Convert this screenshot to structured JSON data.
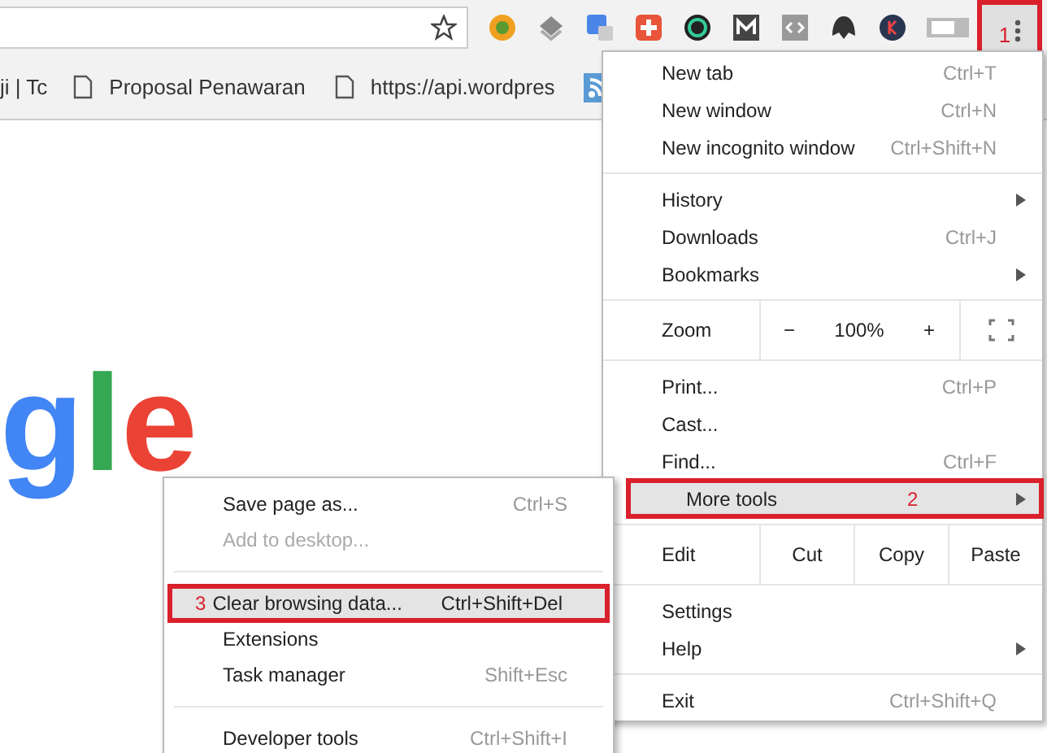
{
  "toolbar": {
    "menu_button": {
      "annotation": "1"
    }
  },
  "bookmarks": [
    {
      "kind": "text",
      "label": "ji | Tc"
    },
    {
      "kind": "page",
      "label": "Proposal Penawaran"
    },
    {
      "kind": "page",
      "label": "https://api.wordpres"
    },
    {
      "kind": "feed"
    }
  ],
  "logo_letters": [
    {
      "text": "g",
      "color": "#4285f4"
    },
    {
      "text": "l",
      "color": "#34a853"
    },
    {
      "text": "e",
      "color": "#ea4335"
    }
  ],
  "menu": [
    {
      "kind": "item",
      "label": "New tab",
      "shortcut": "Ctrl+T",
      "arrow": false,
      "selected": false
    },
    {
      "kind": "item",
      "label": "New window",
      "shortcut": "Ctrl+N",
      "arrow": false,
      "selected": false
    },
    {
      "kind": "item",
      "label": "New incognito window",
      "shortcut": "Ctrl+Shift+N",
      "arrow": false,
      "selected": false
    },
    {
      "kind": "separator"
    },
    {
      "kind": "item",
      "label": "History",
      "arrow": true,
      "selected": false
    },
    {
      "kind": "item",
      "label": "Downloads",
      "shortcut": "Ctrl+J",
      "arrow": false,
      "selected": false
    },
    {
      "kind": "item",
      "label": "Bookmarks",
      "arrow": true,
      "selected": false
    },
    {
      "kind": "separator"
    },
    {
      "kind": "zoom",
      "label": "Zoom",
      "minus": "−",
      "value": "100%",
      "plus": "+"
    },
    {
      "kind": "separator"
    },
    {
      "kind": "item",
      "label": "Print...",
      "shortcut": "Ctrl+P",
      "arrow": false,
      "selected": false
    },
    {
      "kind": "item",
      "label": "Cast...",
      "arrow": false,
      "selected": false
    },
    {
      "kind": "item",
      "label": "Find...",
      "shortcut": "Ctrl+F",
      "arrow": false,
      "selected": false
    },
    {
      "kind": "item",
      "label": "More tools",
      "annotation": "2",
      "arrow": true,
      "selected": true
    },
    {
      "kind": "separator"
    },
    {
      "kind": "edit",
      "label": "Edit",
      "buttons": [
        "Cut",
        "Copy",
        "Paste"
      ]
    },
    {
      "kind": "separator"
    },
    {
      "kind": "item",
      "label": "Settings",
      "arrow": false,
      "selected": false
    },
    {
      "kind": "item",
      "label": "Help",
      "arrow": true,
      "selected": false
    },
    {
      "kind": "separator"
    },
    {
      "kind": "item",
      "label": "Exit",
      "shortcut": "Ctrl+Shift+Q",
      "arrow": false,
      "selected": false
    }
  ],
  "submenu": [
    {
      "kind": "item",
      "label": "Save page as...",
      "shortcut": "Ctrl+S",
      "disabled": false,
      "selected": false
    },
    {
      "kind": "item",
      "label": "Add to desktop...",
      "disabled": true,
      "selected": false
    },
    {
      "kind": "separator"
    },
    {
      "kind": "item",
      "label": "Clear browsing data...",
      "shortcut": "Ctrl+Shift+Del",
      "annotation": "3",
      "disabled": false,
      "selected": true
    },
    {
      "kind": "item",
      "label": "Extensions",
      "disabled": false,
      "selected": false
    },
    {
      "kind": "item",
      "label": "Task manager",
      "shortcut": "Shift+Esc",
      "disabled": false,
      "selected": false
    },
    {
      "kind": "separator"
    },
    {
      "kind": "item",
      "label": "Developer tools",
      "shortcut": "Ctrl+Shift+I",
      "disabled": false,
      "selected": false
    }
  ]
}
